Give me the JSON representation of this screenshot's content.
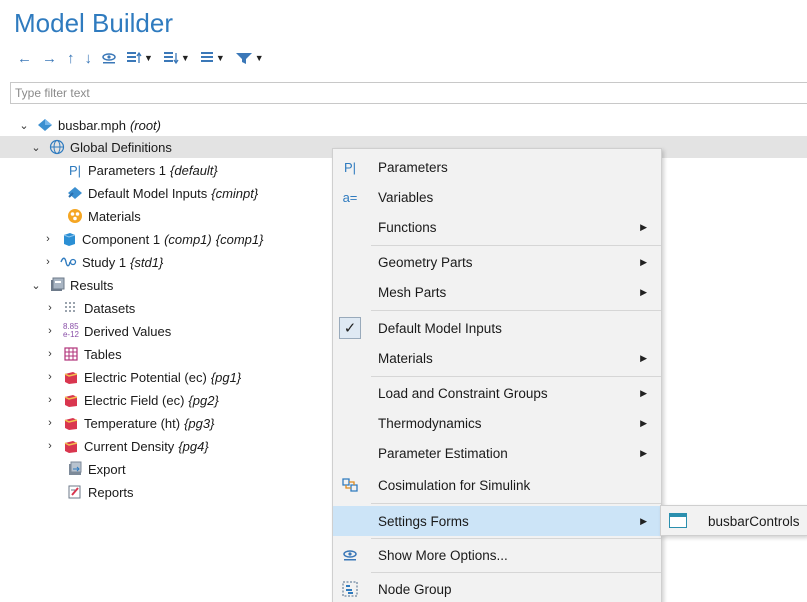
{
  "header": {
    "title": "Model Builder"
  },
  "toolbar": {
    "buttons": [
      {
        "name": "back-arrow-icon",
        "glyph": "←"
      },
      {
        "name": "forward-arrow-icon",
        "glyph": "→"
      },
      {
        "name": "up-arrow-icon",
        "glyph": "↑"
      },
      {
        "name": "down-arrow-icon",
        "glyph": "↓"
      },
      {
        "name": "show-more-options-icon",
        "glyph": "≈"
      },
      {
        "name": "expand-sections-icon",
        "glyph": "⊞↑",
        "caret": true
      },
      {
        "name": "collapse-sections-icon",
        "glyph": "⊟↓",
        "caret": true
      },
      {
        "name": "list-view-icon",
        "glyph": "≣",
        "caret": true
      },
      {
        "name": "filter-nodes-icon",
        "glyph": "▼",
        "caret": true
      }
    ]
  },
  "filter": {
    "placeholder": "Type filter text",
    "value": ""
  },
  "tree": {
    "root": {
      "label": "busbar.mph",
      "tag": "(root)"
    },
    "global_definitions": {
      "label": "Global Definitions"
    },
    "parameters": {
      "label": "Parameters 1",
      "tag": "{default}"
    },
    "default_model_inputs": {
      "label": "Default Model Inputs",
      "tag": "{cminpt}"
    },
    "materials": {
      "label": "Materials"
    },
    "component": {
      "label": "Component 1",
      "tag1": "(comp1)",
      "tag2": "{comp1}"
    },
    "study": {
      "label": "Study 1",
      "tag": "{std1}"
    },
    "results": {
      "label": "Results"
    },
    "datasets": {
      "label": "Datasets"
    },
    "derived_values": {
      "label": "Derived Values"
    },
    "tables": {
      "label": "Tables"
    },
    "electric_potential": {
      "label": "Electric Potential (ec)",
      "tag": "{pg1}"
    },
    "electric_field": {
      "label": "Electric Field (ec)",
      "tag": "{pg2}"
    },
    "temperature": {
      "label": "Temperature (ht)",
      "tag": "{pg3}"
    },
    "current_density": {
      "label": "Current Density",
      "tag": "{pg4}"
    },
    "export": {
      "label": "Export"
    },
    "reports": {
      "label": "Reports"
    }
  },
  "context_menu": {
    "parameters": "Parameters",
    "variables": "Variables",
    "functions": "Functions",
    "geometry_parts": "Geometry Parts",
    "mesh_parts": "Mesh Parts",
    "default_model_inputs": "Default Model Inputs",
    "materials": "Materials",
    "load_constraint_groups": "Load and Constraint Groups",
    "thermodynamics": "Thermodynamics",
    "parameter_estimation": "Parameter Estimation",
    "cosimulation": "Cosimulation for Simulink",
    "settings_forms": "Settings Forms",
    "show_more_options": "Show More Options...",
    "node_group": "Node Group"
  },
  "submenu": {
    "item": "busbarControls"
  },
  "colors": {
    "accent": "#2f7bbf",
    "highlight": "#cce4f7",
    "selected_row": "#e3e3e3",
    "menu_bg": "#f2f2f2"
  }
}
